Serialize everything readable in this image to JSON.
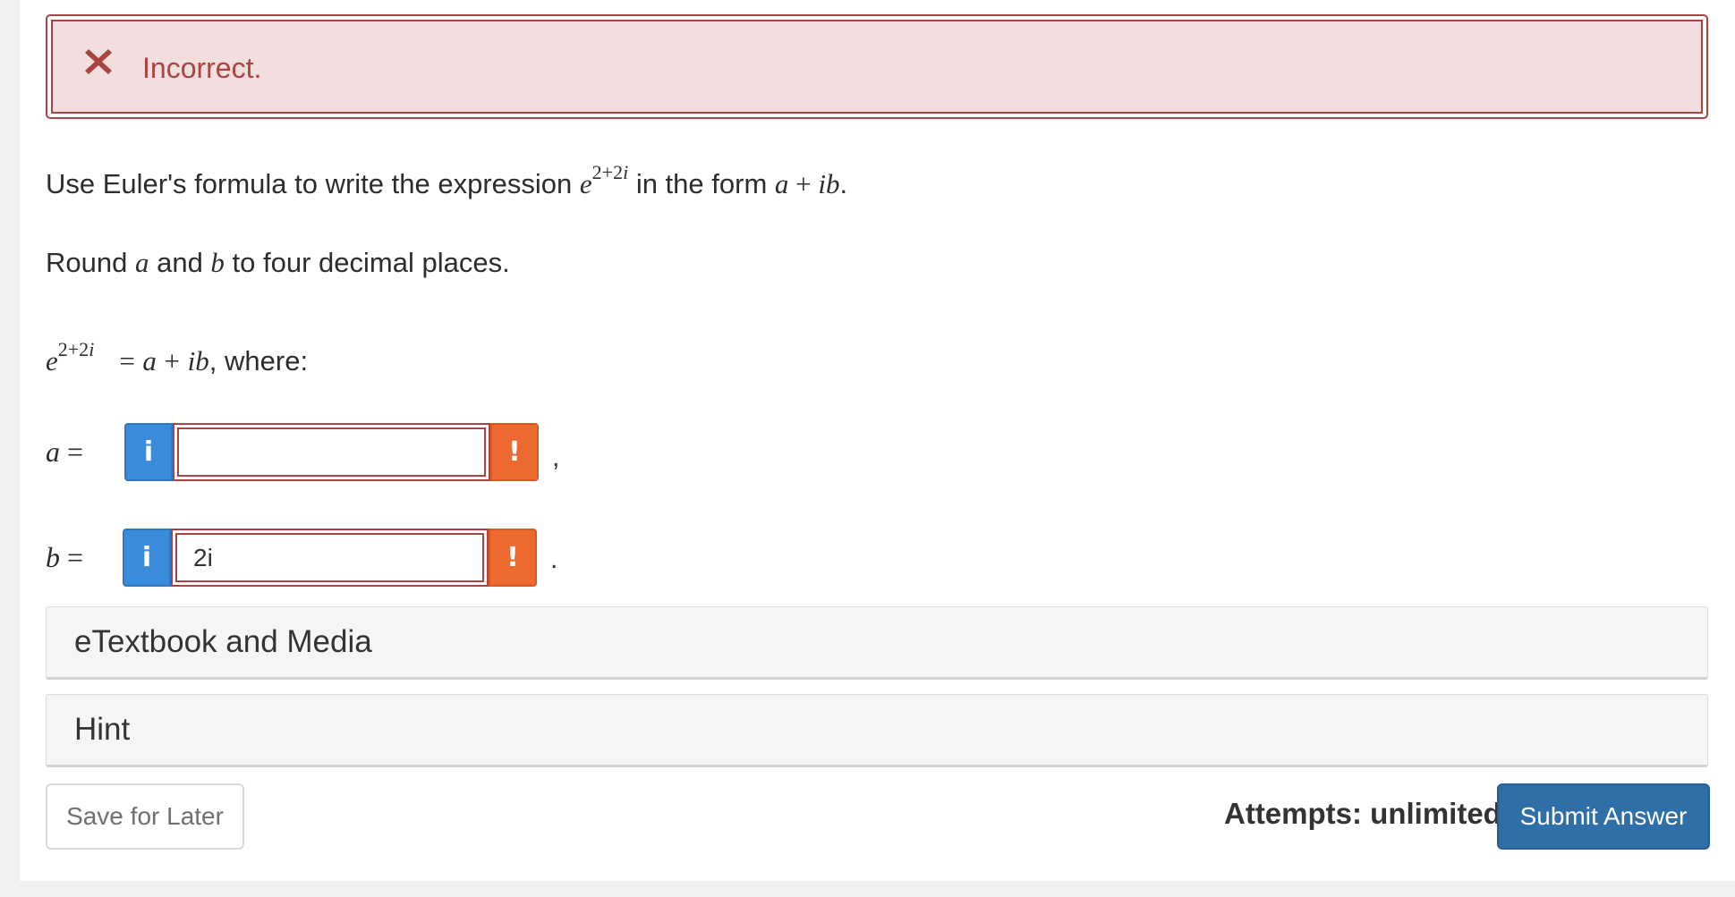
{
  "feedback": {
    "status_text": "Incorrect.",
    "icon": "x-mark-icon",
    "color": "#a94442"
  },
  "question": {
    "line1_before": "Use Euler's formula to write the expression ",
    "expr_base": "e",
    "expr_exponent_num": "2+2",
    "expr_exponent_var": "i",
    "line1_middle": " in the form ",
    "form_a": "a",
    "form_plus": " + ",
    "form_ib": "ib",
    "line1_end": ".",
    "line2_before": "Round ",
    "line2_a": "a",
    "line2_and": " and ",
    "line2_b": "b",
    "line2_after": " to four decimal places."
  },
  "equation": {
    "base": "e",
    "exponent_num": "2+2",
    "exponent_var": "i",
    "equals": "=",
    "rhs_a": "a",
    "rhs_plus": "+",
    "rhs_ib": "ib",
    "suffix": ", where:"
  },
  "answers": [
    {
      "label_var": "a",
      "label_eq": "=",
      "info_label": "i",
      "value": "",
      "warn_label": "!",
      "trailing_punct": ","
    },
    {
      "label_var": "b",
      "label_eq": "=",
      "info_label": "i",
      "value": "2i",
      "warn_label": "!",
      "trailing_punct": "."
    }
  ],
  "panels": {
    "etextbook": "eTextbook and Media",
    "hint": "Hint"
  },
  "footer": {
    "save_label": "Save for Later",
    "attempts_label": "Attempts: unlimited",
    "submit_label": "Submit Answer"
  },
  "colors": {
    "error": "#a94442",
    "error_bg": "#f2dede",
    "info_button": "#3a8bdc",
    "warning_button": "#ec6a2f",
    "submit_button": "#2f6fa8"
  }
}
